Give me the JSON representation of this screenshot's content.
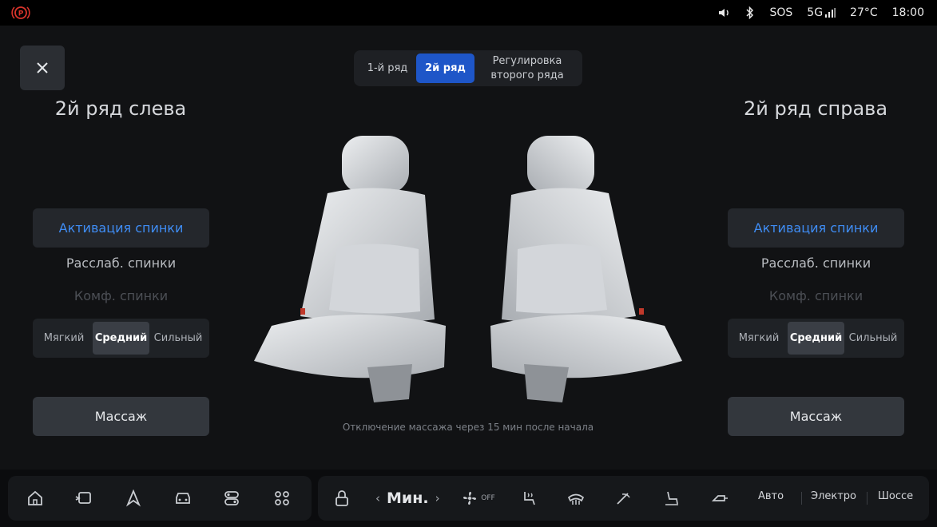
{
  "status": {
    "sos": "SOS",
    "network": "5G",
    "temperature": "27°C",
    "time": "18:00"
  },
  "tabs": {
    "row1": "1-й ряд",
    "row2": "2й ряд",
    "adjust": "Регулировка\nвторого ряда"
  },
  "left_panel": {
    "title": "2й ряд слева",
    "activate": "Активация спинки",
    "relax": "Расслаб. спинки",
    "comfort": "Комф. спинки",
    "intensity": [
      "Мягкий",
      "Средний",
      "Сильный"
    ],
    "massage": "Массаж"
  },
  "right_panel": {
    "title": "2й ряд справа",
    "activate": "Активация спинки",
    "relax": "Расслаб. спинки",
    "comfort": "Комф. спинки",
    "intensity": [
      "Мягкий",
      "Средний",
      "Сильный"
    ],
    "massage": "Массаж"
  },
  "note": "Отключение массажа через 15 мин после начала",
  "bottom": {
    "fan_level": "Мин.",
    "fan_off": "OFF",
    "modes": [
      "Авто",
      "Электро",
      "Шоссе"
    ]
  },
  "colors": {
    "accent": "#1e56c8",
    "accent_text": "#3f8df5",
    "park_red": "#d9342b"
  }
}
